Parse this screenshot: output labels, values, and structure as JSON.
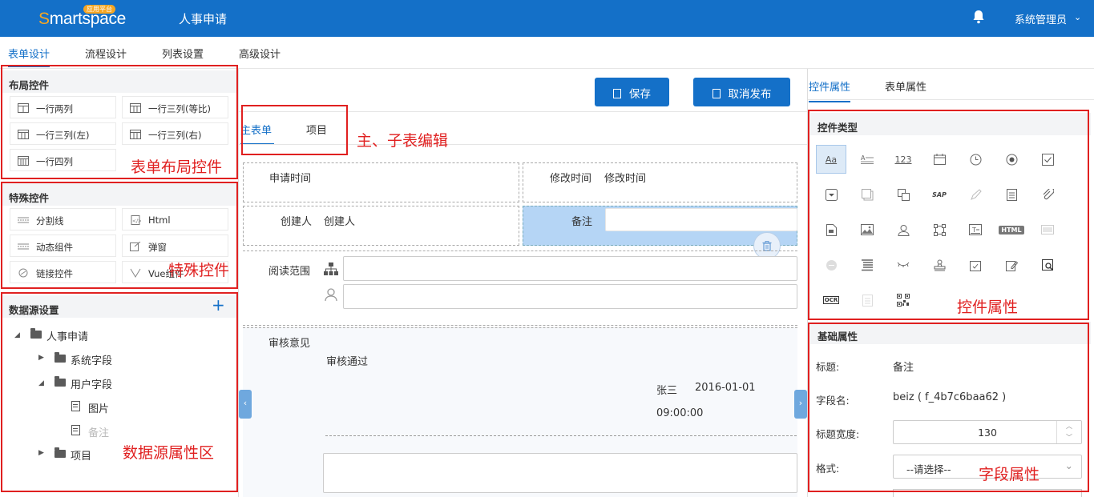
{
  "header": {
    "logo_text_s": "S",
    "logo_text_rest": "martspace",
    "logo_badge": "应用平台",
    "app_title": "人事申请",
    "user": "系统管理员"
  },
  "main_tabs": [
    "表单设计",
    "流程设计",
    "列表设置",
    "高级设计"
  ],
  "left": {
    "layout_head": "布局控件",
    "layout_items": [
      "一行两列",
      "一行三列(等比)",
      "一行三列(左)",
      "一行三列(右)",
      "一行四列"
    ],
    "special_head": "特殊控件",
    "special_items": [
      "分割线",
      "Html",
      "动态组件",
      "弹窗",
      "链接控件",
      "Vue组件"
    ],
    "ds_head": "数据源设置",
    "ds_add": "+",
    "tree": {
      "root": "人事申请",
      "sys": "系统字段",
      "user": "用户字段",
      "pic": "图片",
      "note": "备注",
      "proj": "项目"
    }
  },
  "annotations": {
    "layout": "表单布局控件",
    "special": "特殊控件",
    "datasource": "数据源属性区",
    "subtable": "主、子表编辑",
    "ctrl_attr": "控件属性",
    "field_attr": "字段属性"
  },
  "center": {
    "save": "保存",
    "unpublish": "取消发布",
    "sub_tabs": [
      "主表单",
      "项目"
    ],
    "apply_time": "申请时间",
    "modify_time_label": "修改时间",
    "modify_time_value": "修改时间",
    "creator_label": "创建人",
    "creator_value": "创建人",
    "note_label": "备注",
    "read_scope": "阅读范围",
    "review_label": "审核意见",
    "review_value": "审核通过",
    "reviewer": "张三",
    "review_date": "2016-01-01",
    "review_time": "09:00:00"
  },
  "right": {
    "tabs": [
      "控件属性",
      "表单属性"
    ],
    "type_head": "控件类型",
    "icons": [
      "text-icon",
      "textarea-icon",
      "number-icon",
      "date-icon",
      "time-icon",
      "radio-icon",
      "checkbox-icon",
      "select-icon",
      "multi-icon",
      "copy-icon",
      "sap-icon",
      "pen-icon",
      "doc-icon",
      "attach-icon",
      "file-icon",
      "image-icon",
      "person-icon",
      "flow-icon",
      "textblock-icon",
      "html-icon",
      "barcode-icon",
      "circle-icon",
      "list-icon",
      "eye-icon",
      "stamp-icon",
      "check-doc-icon",
      "edit-doc-icon",
      "search-doc-icon",
      "ocr-icon",
      "page-icon",
      "qrcode-icon"
    ],
    "icon_text": {
      "text": "Aa",
      "number": "123",
      "html": "HTML",
      "sap": "SAP",
      "ocr": "OCR"
    },
    "base_head": "基础属性",
    "title_lbl": "标题:",
    "title_val": "备注",
    "field_lbl": "字段名:",
    "field_val": "beiz ( f_4b7c6baa62 )",
    "width_lbl": "标题宽度:",
    "width_val": "130",
    "format_lbl": "格式:",
    "format_val": "--请选择--"
  }
}
